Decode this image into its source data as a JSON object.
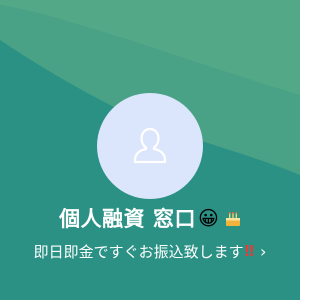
{
  "profile": {
    "name": "個人融資 窓口",
    "name_emoji": "😀",
    "badge_icon": "cake-icon",
    "status_message": "即日即金ですぐお振込致します",
    "status_mark": "‼",
    "chevron": "›",
    "avatar_icon": "person-placeholder-icon"
  },
  "colors": {
    "background_main": "#2a9184",
    "background_light": "#4fa486",
    "avatar_bg": "#dbe5fb",
    "accent_red": "#e23c3c"
  }
}
